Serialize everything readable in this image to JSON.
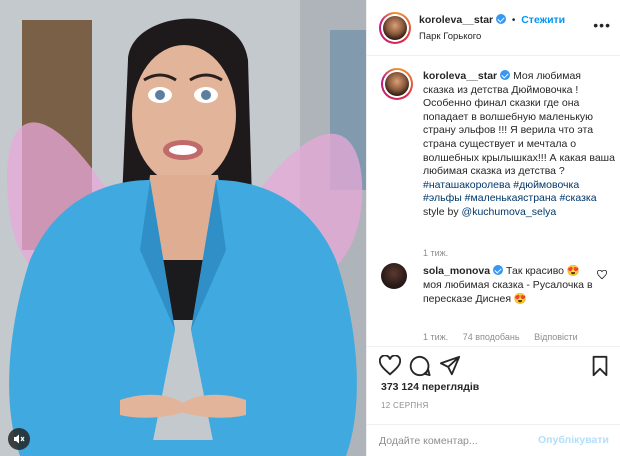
{
  "post": {
    "username": "koroleva__star",
    "follow_label": "Стежити",
    "separator": "•",
    "location": "Парк Горького",
    "more_icon": "more-horizontal-icon"
  },
  "caption": {
    "username": "koroleva__star",
    "text": "Моя любимая сказка из детства Дюймовочка ! Особенно финал сказки где она попадает в волшебную маленькую страну эльфов !!! Я верила что эта страна существует и мечтала о волшебных крылышках!!! А какая ваша любимая сказка из детства ?",
    "hashtags": "#наташакоролева #дюймовочка #эльфы #маленькаястрана #сказка",
    "style_by_label": "style by",
    "style_by_handle": "@kuchumova_selya",
    "time": "1 тиж."
  },
  "comment": {
    "username": "sola_monova",
    "text": "Так красиво 😍 моя любимая сказка - Русалочка в пересказе Диснея 😍",
    "time": "1 тиж.",
    "likes": "74 вподобань",
    "reply_label": "Відповісти"
  },
  "actions": {
    "views": "373 124 переглядів",
    "date": "12 СЕРПНЯ"
  },
  "add_comment": {
    "placeholder": "Додайте коментар...",
    "post_label": "Опублікувати"
  },
  "colors": {
    "link": "#00376b",
    "accent": "#0095f6",
    "verified": "#3897f0",
    "muted": "#8e8e8e",
    "jacket": "#3fa9e0"
  }
}
